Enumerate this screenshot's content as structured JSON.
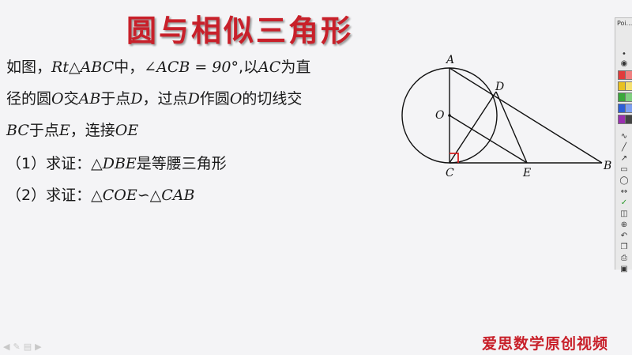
{
  "slide": {
    "title": "圆与相似三角形",
    "problem": {
      "l1a": "如图，",
      "l1b": "Rt△ABC",
      "l1c": "中，",
      "l1d": "∠ACB = 90°",
      "l1e": ",以",
      "l1f": "AC",
      "l1g": "为直",
      "l2a": "径的圆",
      "l2b": "O",
      "l2c": "交",
      "l2d": "AB",
      "l2e": "于点",
      "l2f": "D",
      "l2g": "，过点",
      "l2h": "D",
      "l2i": "作圆",
      "l2j": "O",
      "l2k": "的切线交",
      "l3a": "BC",
      "l3b": "于点",
      "l3c": "E",
      "l3d": "，连接",
      "l3e": "OE"
    },
    "q1": {
      "prefix": "（1）求证：",
      "math": "△DBE",
      "suffix": "是等腰三角形"
    },
    "q2": {
      "prefix": "（2）求证：",
      "math": "△COE∽△CAB"
    },
    "figure_labels": {
      "A": "A",
      "D": "D",
      "O": "O",
      "C": "C",
      "E": "E",
      "B": "B"
    },
    "watermark": "爱思数学原创视频"
  },
  "toolbar": {
    "title": "Poi...",
    "icons": [
      "pen-icon",
      "line-icon",
      "arrow-icon",
      "rect-icon",
      "ellipse-icon",
      "eraser-icon",
      "check-icon",
      "ruler-icon",
      "zoom-icon",
      "undo-icon",
      "copy-icon",
      "print-icon",
      "save-icon"
    ],
    "colors": [
      "#e23b3b",
      "#e8c020",
      "#3aa83a",
      "#2e5fd6",
      "#9a2fb0"
    ]
  },
  "colors": {
    "title": "#c8202a",
    "accent_red": "#d42020"
  }
}
